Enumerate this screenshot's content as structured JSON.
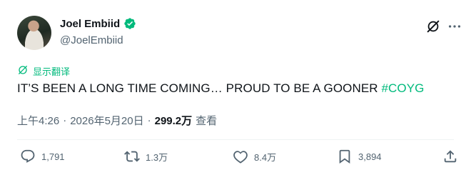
{
  "author": {
    "name": "Joel Embiid",
    "handle": "@JoelEmbiid",
    "verified_color": "#00ba7c"
  },
  "translate": {
    "label": "显示翻译",
    "icon": "translate-icon",
    "color": "#00ba7c"
  },
  "tweet": {
    "text": "IT’S BEEN A LONG TIME COMING… PROUD TO BE A GOONER ",
    "hashtag": "#COYG",
    "hashtag_color": "#00ba7c"
  },
  "meta": {
    "time": "上午4:26",
    "date": "2026年5月20日",
    "separator": "·",
    "views_count": "299.2万",
    "views_label": "查看"
  },
  "actions": {
    "reply": {
      "count": "1,791",
      "icon": "reply-icon"
    },
    "retweet": {
      "count": "1.3万",
      "icon": "retweet-icon"
    },
    "like": {
      "count": "8.4万",
      "icon": "heart-icon"
    },
    "bookmark": {
      "count": "3,894",
      "icon": "bookmark-icon"
    },
    "share": {
      "icon": "share-icon"
    }
  },
  "header_icons": [
    "grok-icon",
    "more-icon"
  ]
}
